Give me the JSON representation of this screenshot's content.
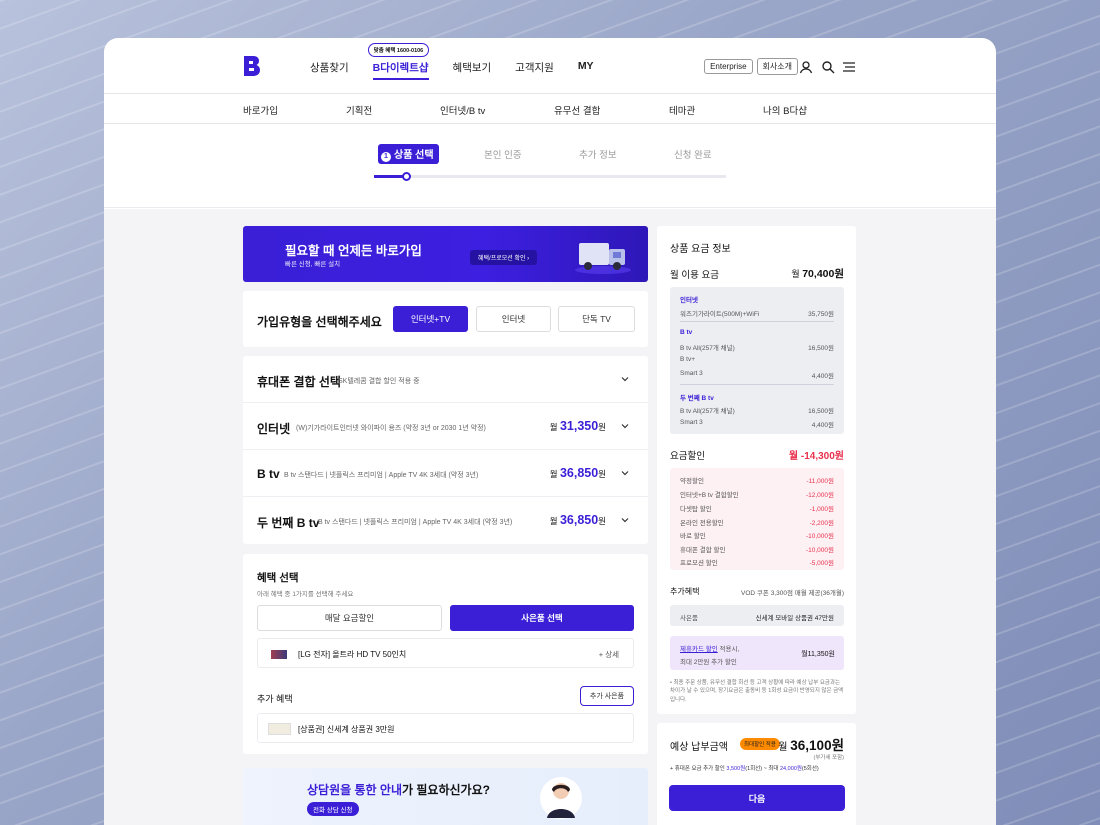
{
  "gnb": {
    "menu": [
      "상품찾기",
      "B다이렉트샵",
      "혜택보기",
      "고객지원",
      "MY"
    ],
    "pill": "맞춤 혜택 1600-0106",
    "enterprise": "Enterprise",
    "company": "회사소개"
  },
  "lnb": [
    "바로가입",
    "기획전",
    "인터넷/B tv",
    "유무선 결합",
    "테마관",
    "나의 B다샵"
  ],
  "steps": {
    "current_num": "1",
    "current": "상품 선택",
    "s2": "본인 인증",
    "s3": "추가 정보",
    "s4": "신청 완료",
    "progress": 0.09
  },
  "banner": {
    "title": "필요할 때 언제든 바로가입",
    "sub": "빠른 신청, 빠른 설치",
    "button": "혜택/프로모션 확인"
  },
  "join": {
    "title": "가입유형을 선택해주세요",
    "options": [
      "인터넷+TV",
      "인터넷",
      "단독 TV"
    ]
  },
  "products": {
    "mobile": {
      "label": "휴대폰 결합 선택",
      "sub": "SK텔레콤 결합 할인 적용 중"
    },
    "internet": {
      "label": "인터넷",
      "sub": "(W)기가라이트인터넷 와이파이 용즈 (약정 3년 or 2030 1년 약정)",
      "unit": "월",
      "price": "31,350",
      "won": "원"
    },
    "btv": {
      "label": "B tv",
      "sub": "B tv 스탠다드 | 넷플릭스 프리미엄 | Apple TV 4K 3세대 (약정 3년)",
      "unit": "월",
      "price": "36,850",
      "won": "원"
    },
    "btv2": {
      "label": "두 번째 B tv",
      "sub": "B tv 스탠다드 | 넷플릭스 프리미엄 | Apple TV 4K 3세대 (약정 3년)",
      "unit": "월",
      "price": "36,850",
      "won": "원"
    }
  },
  "benefit": {
    "title": "혜택 선택",
    "sub": "아래 혜택 중 1가지를 선택해 주세요",
    "opt1": "매달 요금할인",
    "opt2": "사은품 선택",
    "item": "[LG 전자] 올트라 HD TV 50인치",
    "detail": "+ 상세",
    "extra": "추가 혜택",
    "extra_btn": "추가 사은품",
    "gift": "[상품권] 신세계 상품권 3만원"
  },
  "consult": {
    "title_a": "상담원을 통한 안내",
    "title_b": "가 필요하신가요?",
    "button": "전화 상담 신청"
  },
  "side": {
    "title": "상품 요금 정보",
    "monthly": "월 이용 요금",
    "monthly_unit": "월",
    "monthly_val": "70,400원",
    "g1": "인터넷",
    "g1a": "워즈기가라이트(500M)+WiFi",
    "g1a_v": "35,750원",
    "g2": "B tv",
    "g2a": "B tv All(257개 채널)",
    "g2a_v": "16,500원",
    "g2b": "B tv+",
    "g2c": "Smart 3",
    "g2c_v": "4,400원",
    "g3": "두 번째 B tv",
    "g3a": "B tv All(257개 채널)",
    "g3a_v": "16,500원",
    "g3c": "Smart 3",
    "g3c_v": "4,400원",
    "discount": "요금할인",
    "discount_val": "월 -14,300원",
    "d": [
      [
        "약정할인",
        "-11,000원"
      ],
      [
        "인터넷+B tv 결합할인",
        "-12,000원"
      ],
      [
        "다셋탑 할인",
        "-1,000원"
      ],
      [
        "온라인 전용할인",
        "-2,200원"
      ],
      [
        "바로 할인",
        "-10,000원"
      ],
      [
        "휴대폰 결합 할인",
        "-10,000원"
      ],
      [
        "프로모션 할인",
        "-5,000원"
      ]
    ],
    "extra": "추가혜택",
    "extra_desc": "VOD 쿠폰 3,300점 매월 제공(36개월)",
    "gift_lbl": "사은품",
    "gift_val": "신세계 모바일 상품권 47만원",
    "card_a": "제휴카드 할인",
    "card_b": " 적용시,",
    "card_c": "최대 2만원 추가 할인",
    "card_val": "월11,350원",
    "note": "• 최종 주문 상품, 유무선 결합 회선 등 고객 상황에 따라 예상 납부 요금과는 차이가 날 수 있으며, 장기요금은 출동비 등 1회성 요금이 반영되지 않은 금액입니다."
  },
  "payment": {
    "label": "예상 납부금액",
    "badge": "최대할인 적용",
    "unit": "월",
    "value": "36,100원",
    "vat": "(부가세 포함)",
    "promo_a": "+ 휴대폰 요금 추가 할인 ",
    "promo_b": "3,500원",
    "promo_c": "(1회선) ~ 최대 ",
    "promo_d": "24,000원",
    "promo_e": "(5회선)",
    "next": "다음"
  }
}
